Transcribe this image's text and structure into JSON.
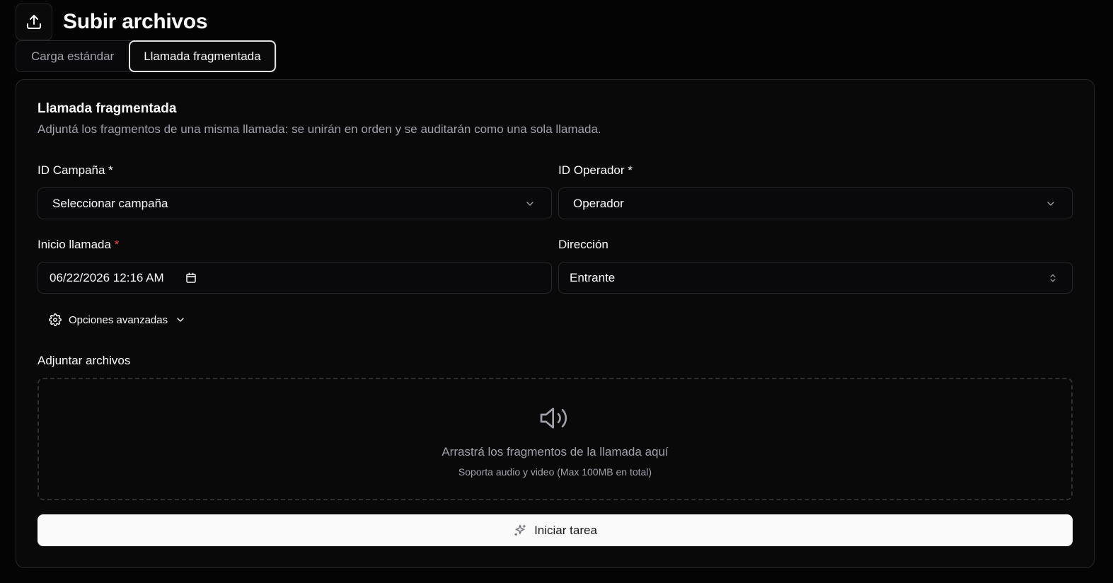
{
  "header": {
    "title": "Subir archivos",
    "icon": "upload-icon"
  },
  "tabs": [
    {
      "label": "Carga estándar",
      "active": false
    },
    {
      "label": "Llamada fragmentada",
      "active": true
    }
  ],
  "card": {
    "title": "Llamada fragmentada",
    "description": "Adjuntá los fragmentos de una misma llamada: se unirán en orden y se auditarán como una sola llamada."
  },
  "form": {
    "campaign": {
      "label": "ID Campaña *",
      "placeholder": "Seleccionar campaña"
    },
    "operator": {
      "label": "ID Operador *",
      "placeholder": "Operador"
    },
    "start": {
      "label": "Inicio llamada",
      "required_mark": "*",
      "value": "06/22/2026 12:16 AM"
    },
    "direction": {
      "label": "Dirección",
      "value": "Entrante"
    },
    "advanced": {
      "label": "Opciones avanzadas"
    },
    "attach": {
      "label": "Adjuntar archivos"
    }
  },
  "dropzone": {
    "main_text": "Arrastrá los fragmentos de la llamada aquí",
    "sub_text": "Soporta audio y video (Max 100MB en total)",
    "icon": "speaker-icon"
  },
  "submit": {
    "label": "Iniciar tarea",
    "icon": "sparkles-icon"
  },
  "colors": {
    "background": "#040405",
    "card": "#09090a",
    "border": "#27272a",
    "muted": "#a1a1aa",
    "required": "#ef4444",
    "primary_button": "#fafafa"
  }
}
